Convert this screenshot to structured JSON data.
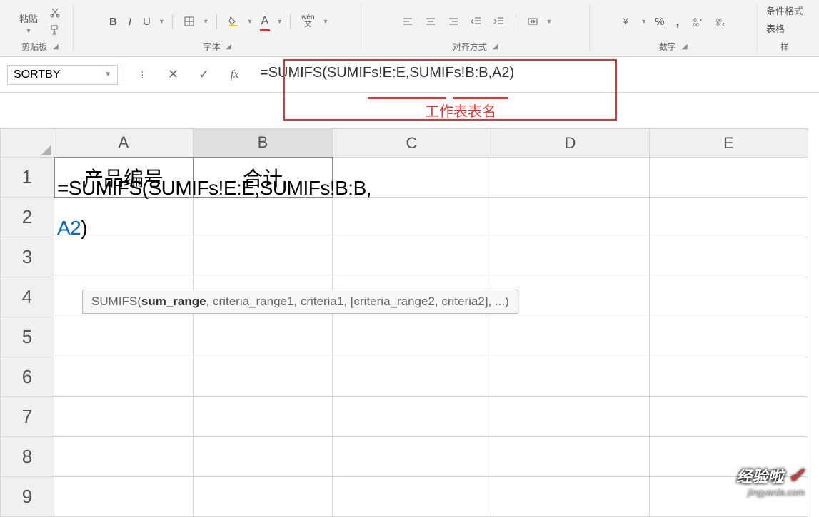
{
  "ribbon": {
    "paste_label": "粘贴",
    "clipboard_label": "剪贴板",
    "font_label": "字体",
    "alignment_label": "对齐方式",
    "number_label": "数字",
    "styles_label": "样",
    "conditional_format": "条件格式",
    "table_format": "表格",
    "bold": "B",
    "italic": "I",
    "underline": "U",
    "font_color": "A",
    "pinyin": "wén",
    "pinyin2": "文",
    "percent": "%",
    "comma": ","
  },
  "formula_bar": {
    "name_box_value": "SORTBY",
    "formula": "=SUMIFS(SUMIFs!E:E,SUMIFs!B:B,A2)"
  },
  "annotation": {
    "label": "工作表表名"
  },
  "columns": [
    "A",
    "B",
    "C",
    "D",
    "E"
  ],
  "rows": [
    "1",
    "2",
    "3",
    "4",
    "5",
    "6",
    "7",
    "8",
    "9"
  ],
  "cells": {
    "a1": "产品编号",
    "b1": "合计",
    "formula_line1": "=SUMIFS(SUMIFs!E:E,SUMIFs!B:B,",
    "formula_a2": "A2",
    "formula_close": ")"
  },
  "tooltip": {
    "fn": "SUMIFS(",
    "p1": "sum_range",
    "rest": ", criteria_range1, criteria1, [criteria_range2, criteria2], ...)"
  },
  "watermark": {
    "text": "经验啦",
    "url": "jingyanla.com"
  }
}
